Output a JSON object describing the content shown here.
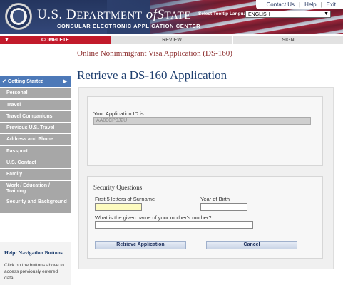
{
  "header": {
    "dept_prefix": "U.S. D",
    "dept_mid": "EPARTMENT",
    "dept_of": "of",
    "dept_state": "S",
    "dept_state_rest": "TATE",
    "subtitle": "CONSULAR ELECTRONIC APPLICATION CENTER",
    "links": [
      "Contact Us",
      "Help",
      "Exit"
    ],
    "language_label": "Select Tooltip Language",
    "language_value": "ENGLISH"
  },
  "nav": {
    "complete": "COMPLETE",
    "review": "REVIEW",
    "sign": "SIGN"
  },
  "form_title": "Online Nonimmigrant Visa Application (DS-160)",
  "page_title": "Retrieve a DS-160 Application",
  "sidebar": {
    "items": [
      {
        "label": "Getting Started"
      },
      {
        "label": "Personal"
      },
      {
        "label": "Travel"
      },
      {
        "label": "Travel Companions"
      },
      {
        "label": "Previous U.S. Travel"
      },
      {
        "label": "Address and Phone"
      },
      {
        "label": "Passport"
      },
      {
        "label": "U.S. Contact"
      },
      {
        "label": "Family"
      },
      {
        "label": "Work / Education / Training"
      },
      {
        "label": "Security and Background"
      }
    ]
  },
  "help": {
    "title": "Help: Navigation Buttons",
    "text": "Click on the buttons above to access previously entered data."
  },
  "retrieve": {
    "app_id_label": "Your Application ID is:",
    "app_id_value": "AA00CP0J2U"
  },
  "security": {
    "title": "Security Questions",
    "surname_label": "First 5 letters of Surname",
    "surname_value": "",
    "birth_year_label": "Year of Birth",
    "birth_year_value": "",
    "question_label": "What is the given name of your mother's mother?",
    "question_value": ""
  },
  "buttons": {
    "retrieve": "Retrieve Application",
    "cancel": "Cancel"
  }
}
